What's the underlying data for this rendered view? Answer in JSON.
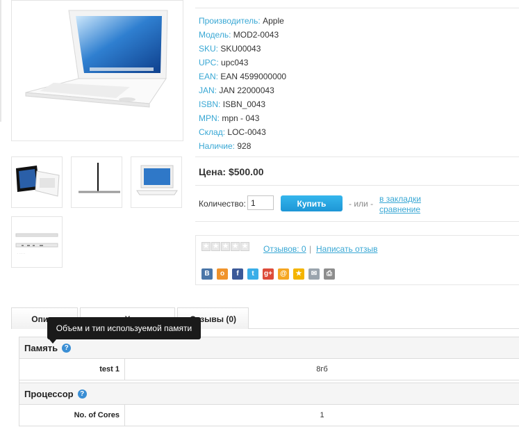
{
  "specs": [
    {
      "key": "Производитель:",
      "value": "Apple"
    },
    {
      "key": "Модель:",
      "value": "MOD2-0043"
    },
    {
      "key": "SKU:",
      "value": "SKU00043"
    },
    {
      "key": "UPC:",
      "value": "upc043"
    },
    {
      "key": "EAN:",
      "value": "EAN 4599000000"
    },
    {
      "key": "JAN:",
      "value": "JAN 22000043"
    },
    {
      "key": "ISBN:",
      "value": "ISBN_0043"
    },
    {
      "key": "MPN:",
      "value": "mpn - 043"
    },
    {
      "key": "Склад:",
      "value": "LOC-0043"
    },
    {
      "key": "Наличие:",
      "value": "928"
    }
  ],
  "price": {
    "text": "Цена: $500.00"
  },
  "purchase": {
    "qty_label": "Количество:",
    "qty_value": "1",
    "buy_label": "Купить",
    "or_text": "- или -",
    "wishlist_label": "в закладки",
    "compare_label": "сравнение"
  },
  "rating": {
    "stars_total": 5,
    "stars_filled": 0,
    "reviews_link": "Отзывов: 0",
    "separator": "|",
    "write_review": "Написать отзыв"
  },
  "share_icons": [
    {
      "name": "vkontakte-icon",
      "glyph": "B",
      "color": "#4a76a8"
    },
    {
      "name": "odnoklassniki-icon",
      "glyph": "о",
      "color": "#f0932b"
    },
    {
      "name": "facebook-icon",
      "glyph": "f",
      "color": "#3b5998"
    },
    {
      "name": "twitter-icon",
      "glyph": "t",
      "color": "#3aaee8"
    },
    {
      "name": "google-plus-icon",
      "glyph": "g+",
      "color": "#dd4b39"
    },
    {
      "name": "mailru-icon",
      "glyph": "@",
      "color": "#f5a623"
    },
    {
      "name": "favorites-star-icon",
      "glyph": "★",
      "color": "#f4b400"
    },
    {
      "name": "email-icon",
      "glyph": "✉",
      "color": "#9aa4ad"
    },
    {
      "name": "print-icon",
      "glyph": "⎙",
      "color": "#8d8d8d"
    }
  ],
  "tabs": [
    {
      "label": "Описа",
      "name": "tab-description"
    },
    {
      "label": "Х",
      "name": "tab-specifications"
    },
    {
      "label": "Отзывы (0)",
      "name": "tab-reviews"
    }
  ],
  "tooltip": {
    "text": "Объем и тип используемой памяти"
  },
  "spec_groups": [
    {
      "title": "Память",
      "rows": [
        {
          "name": "test 1",
          "value": "8гб"
        }
      ]
    },
    {
      "title": "Процессор",
      "rows": [
        {
          "name": "No. of Cores",
          "value": "1"
        }
      ]
    }
  ],
  "colors": {
    "accent": "#38a7d4",
    "button": "#1e96d6",
    "tooltip_bg": "#1a1a1a"
  }
}
